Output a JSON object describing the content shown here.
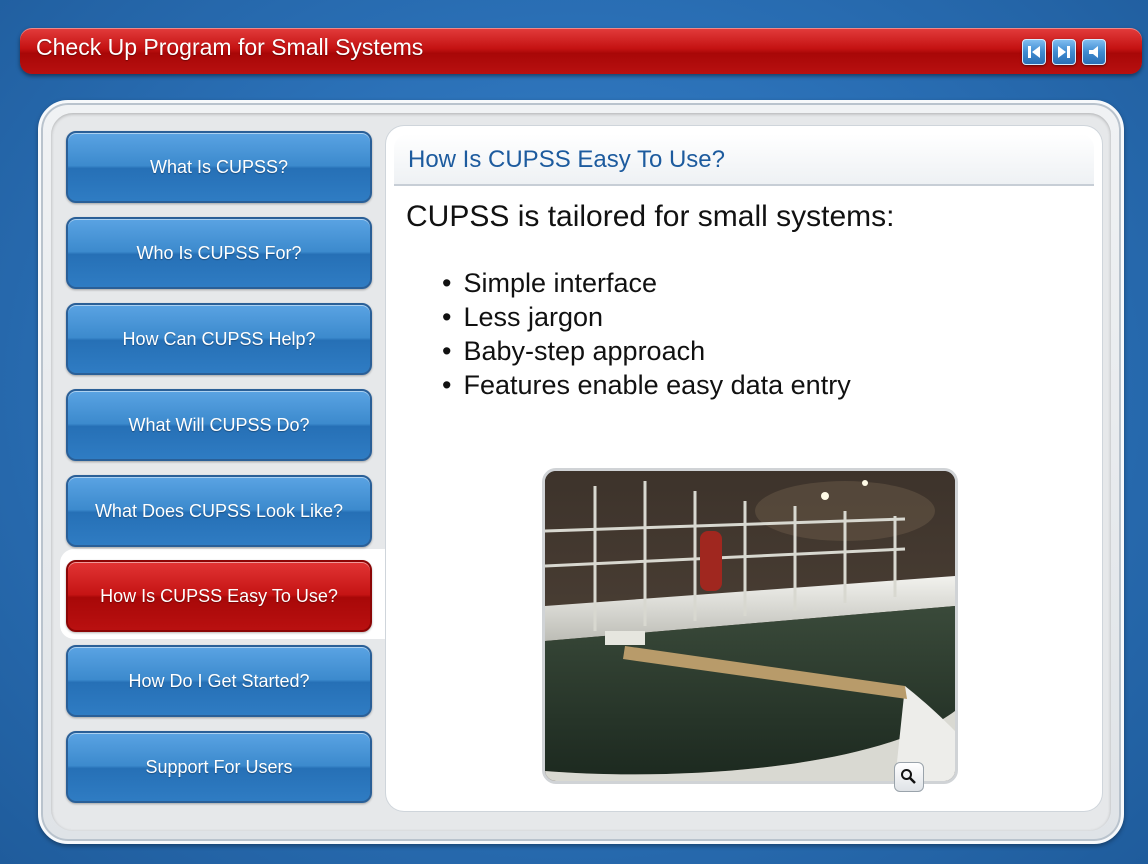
{
  "app": {
    "title": "Check Up Program for Small Systems",
    "controls": [
      {
        "icon": "back-icon"
      },
      {
        "icon": "forward-icon"
      },
      {
        "icon": "audio-icon"
      }
    ]
  },
  "nav": {
    "items": [
      {
        "label": "What Is CUPSS?",
        "active": false
      },
      {
        "label": "Who Is CUPSS For?",
        "active": false
      },
      {
        "label": "How Can CUPSS Help?",
        "active": false
      },
      {
        "label": "What Will CUPSS Do?",
        "active": false
      },
      {
        "label": "What Does CUPSS Look Like?",
        "active": false
      },
      {
        "label": "How Is CUPSS Easy To Use?",
        "active": true
      },
      {
        "label": "How Do I Get Started?",
        "active": false
      },
      {
        "label": "Support For Users",
        "active": false
      }
    ]
  },
  "content": {
    "heading": "How Is CUPSS Easy To Use?",
    "subheading": "CUPSS is tailored for small systems:",
    "bullets": [
      "Simple interface",
      "Less jargon",
      "Baby-step approach",
      "Features enable easy data entry"
    ],
    "zoom_icon": "magnifier-icon"
  },
  "colors": {
    "accent_red": "#c41212",
    "accent_blue": "#2a6fb5",
    "heading_blue": "#1d5b9e"
  }
}
